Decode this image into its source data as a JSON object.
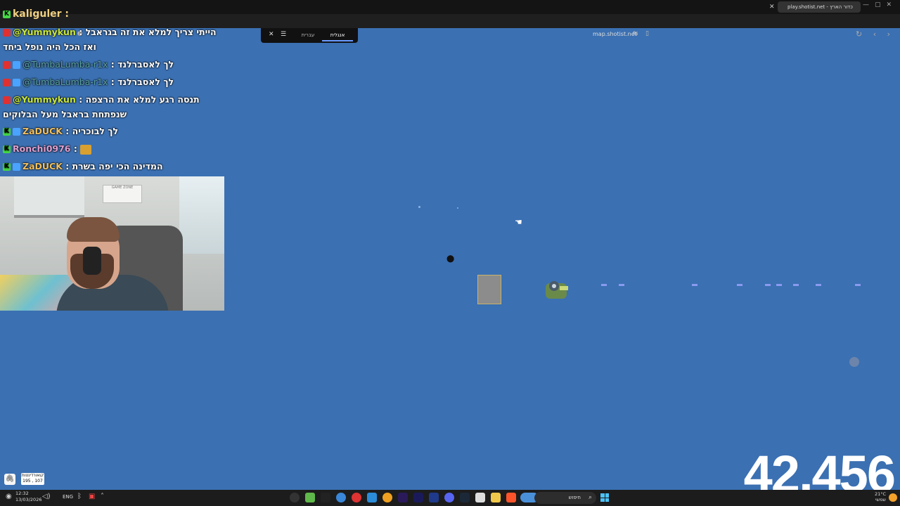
{
  "browser": {
    "tab_title": "play.shotist.net - כדור הארץ",
    "address": "map.shotist.net"
  },
  "overlay": {
    "top_user": "kaliguler :"
  },
  "chat": [
    {
      "user": "@Yummykun",
      "sep": " : ",
      "text": "הייתי צריך למלא את זה בגראבל"
    },
    {
      "user": "",
      "sep": "",
      "text": "ואז הכל היה נופל ביחד"
    },
    {
      "user": "@TumbaLumba-r1x",
      "sep": " : ",
      "text": "לך לאסברלנד"
    },
    {
      "user": "@TumbaLumba-r1x",
      "sep": " : ",
      "text": "לך לאסברלנד"
    },
    {
      "user": "@Yummykun",
      "sep": " : ",
      "text": "תנסה רגע למלא את הרצפה"
    },
    {
      "user": "",
      "sep": "",
      "text": "שנפתחת בראבל מעל הבלוקים"
    },
    {
      "user": "ZaDUCK",
      "sep": " : ",
      "text": "לך לבוכריה"
    },
    {
      "user": "Ronchi0976",
      "sep": " : ",
      "text": ""
    },
    {
      "user": "ZaDUCK",
      "sep": " : ",
      "text": "המדינה הכי יפה בשרת"
    }
  ],
  "toolbar": {
    "tab_english": "אנגלית",
    "tab_hebrew": "עברית"
  },
  "webcam_sign": "GAME ZONE",
  "counter": "42,456",
  "coords": {
    "label": "קואורדינטות",
    "value": "195 , 107"
  },
  "taskbar": {
    "time": "12:32",
    "date": "13/03/2026",
    "lang": "ENG",
    "search": "חיפוש",
    "weather_temp": "21°C",
    "weather_desc": "שמשי"
  },
  "colors": {
    "game_bg": "#3b70b2",
    "platform_dash": "#8a9af0"
  }
}
